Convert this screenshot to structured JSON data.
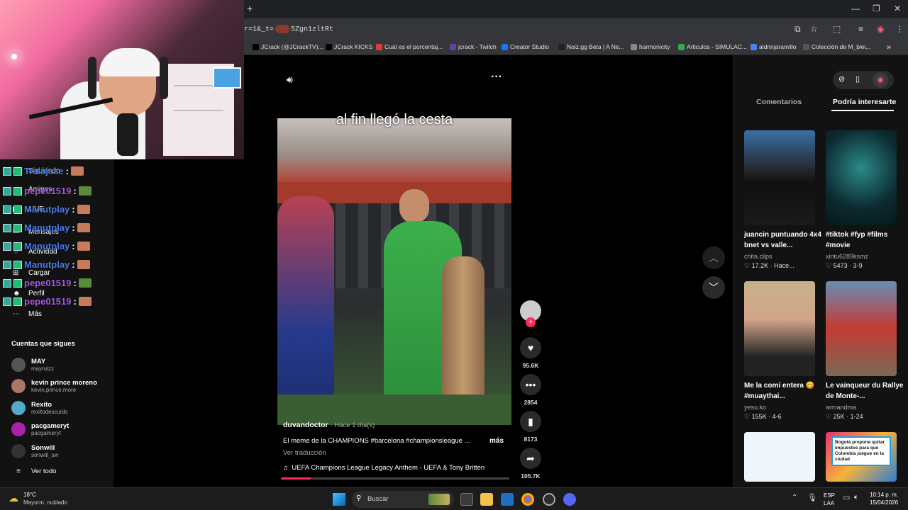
{
  "browser": {
    "url_fragment": "r=1&_t=",
    "url_suffix": "5Zgn1zltRt",
    "new_tab_symbol": "+",
    "bookmarks": [
      {
        "label": "JCrack (@JCrackTV)...",
        "color": "#000000"
      },
      {
        "label": "JCrack KICKS",
        "color": "#000000"
      },
      {
        "label": "Cuál es el porcentaj...",
        "color": "#e53935"
      },
      {
        "label": "jcrack - Twitch",
        "color": "#6441a5"
      },
      {
        "label": "Creator Studio",
        "color": "#1877f2"
      },
      {
        "label": "Noiz.gg Beta | A Ne...",
        "color": "#222222"
      },
      {
        "label": "harmonicity",
        "color": "#888888"
      },
      {
        "label": "Articulos - SIMULAC...",
        "color": "#34a853"
      },
      {
        "label": "aldrinjaramillo",
        "color": "#4285f4"
      },
      {
        "label": "Colección de M_blei...",
        "color": "#555555"
      }
    ]
  },
  "chat": [
    {
      "user": "Tralajase",
      "color": "#4a7be8"
    },
    {
      "user": "pepe01519",
      "color": "#a35be0"
    },
    {
      "user": "Manutplay",
      "color": "#4a7be8"
    },
    {
      "user": "Manutplay",
      "color": "#4a7be8"
    },
    {
      "user": "Manutplay",
      "color": "#4a7be8"
    },
    {
      "user": "Manutplay",
      "color": "#4a7be8"
    },
    {
      "user": "pepe01519",
      "color": "#a35be0"
    },
    {
      "user": "pepe01519",
      "color": "#a35be0"
    }
  ],
  "chat_separator": ":",
  "nav": {
    "items": [
      "Siguiendo",
      "Amigos",
      "LIVE",
      "Mensajes",
      "Actividad",
      "Cargar",
      "Perfil",
      "Más"
    ]
  },
  "following": {
    "title": "Cuentas que sigues",
    "accounts": [
      {
        "name": "MAY",
        "handle": "mayruizz",
        "color": "#555"
      },
      {
        "name": "kevin prince moreno",
        "handle": "kevin.prince.more",
        "color": "#a76"
      },
      {
        "name": "Rexito",
        "handle": "rexitodescuido",
        "color": "#5ac"
      },
      {
        "name": "pacgameryt",
        "handle": "pacgameryt",
        "color": "#a2a"
      },
      {
        "name": "Sonwill",
        "handle": "sonwill_sw",
        "color": "#333"
      }
    ],
    "see_all": "Ver todo"
  },
  "video": {
    "overlay": "al fin llegó la cesta",
    "author": "duvandoctor",
    "time": "· Hace 1 día(s)",
    "caption": "El meme de la CHAMPIONS #barcelona #championsleague ...",
    "more": "más",
    "translate": "Ver traducción",
    "music": "UEFA Champions League Legacy Anthem - UEFA & Tony Britten",
    "progress": 0.13,
    "likes": "95.6K",
    "comments": "2854",
    "saves": "8173",
    "shares": "105.7K"
  },
  "right": {
    "tabs": [
      "Comentarios",
      "Podría interesarte"
    ],
    "items": [
      {
        "title": "juancin puntuando 4x4 bnet vs valle...",
        "user": "chita.clips",
        "likes": "17.2K",
        "date": "Hace..."
      },
      {
        "title": "#tiktok #fyp #films #movie",
        "user": "xintu6289ksmz",
        "likes": "5473",
        "date": "3-9"
      },
      {
        "title": "Me la comí entera 😋#muaythai...",
        "user": "yesu.ko",
        "likes": "155K",
        "date": "4-6"
      },
      {
        "title": "Le vainqueur du Rallye de Monte-...",
        "user": "armandma",
        "likes": "25K",
        "date": "1-24"
      },
      {
        "title": "",
        "user": "",
        "likes": "",
        "date": ""
      },
      {
        "title": "Bogotá propone quitar impuestos para que Colombia juegue en la ciudad",
        "user": "",
        "likes": "",
        "date": ""
      }
    ]
  },
  "taskbar": {
    "temp": "18°C",
    "weather": "Mayorm. nublado",
    "search": "Buscar",
    "lang": "ESP",
    "lang2": "LAA",
    "time": "10:14 p. m.",
    "date": "15/04/2026"
  }
}
